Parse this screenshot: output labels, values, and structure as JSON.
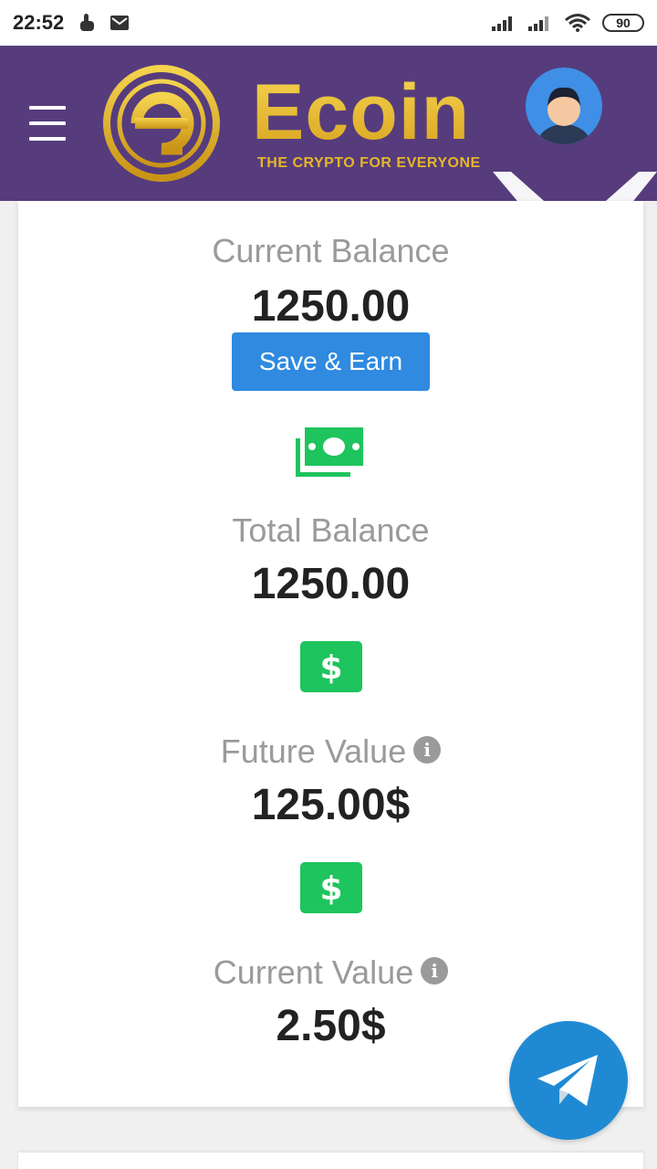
{
  "status_bar": {
    "time": "22:52",
    "battery": "90"
  },
  "header": {
    "brand_name": "Ecoin",
    "tagline": "THE CRYPTO FOR EVERYONE",
    "colors": {
      "background": "#563c7c",
      "gold": "#e6b52b"
    }
  },
  "balances": {
    "current_balance_label": "Current Balance",
    "current_balance_value": "1250.00",
    "save_earn_label": "Save & Earn",
    "total_balance_label": "Total Balance",
    "total_balance_value": "1250.00",
    "future_value_label": "Future Value",
    "future_value_value": "125.00$",
    "current_value_label": "Current Value",
    "current_value_value": "2.50$"
  },
  "icons": {
    "money": "money-bills-icon",
    "dollar": "dollar-icon",
    "info": "info-icon",
    "telegram": "telegram-icon"
  },
  "colors": {
    "accent_blue": "#2f8ae0",
    "green": "#1ec45d",
    "telegram": "#1f8ad3"
  }
}
